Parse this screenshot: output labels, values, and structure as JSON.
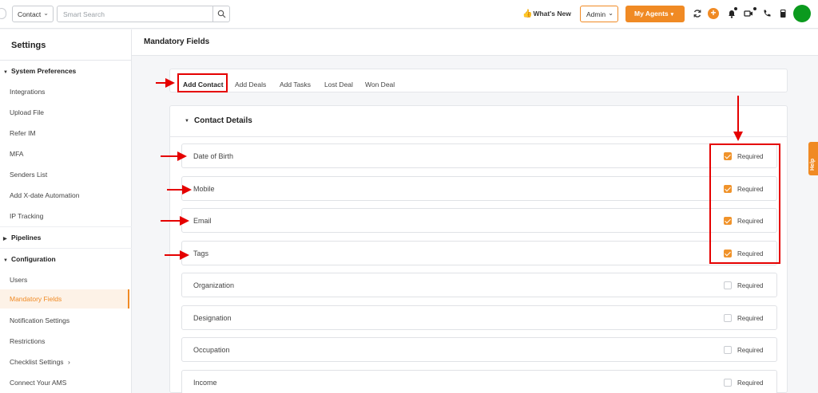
{
  "topbar": {
    "entity_select": "Contact",
    "search_placeholder": "Smart Search",
    "whats_new": "What's New",
    "admin_select": "Admin",
    "agents_button": "My Agents"
  },
  "sidebar": {
    "title": "Settings",
    "groups": {
      "system_preferences": "System Preferences",
      "pipelines": "Pipelines",
      "configuration": "Configuration"
    },
    "items": {
      "integrations": "Integrations",
      "upload_file": "Upload File",
      "refer_im": "Refer IM",
      "mfa": "MFA",
      "senders_list": "Senders List",
      "add_xdate": "Add X-date Automation",
      "ip_tracking": "IP Tracking",
      "users": "Users",
      "mandatory_fields": "Mandatory Fields",
      "notification_settings": "Notification Settings",
      "restrictions": "Restrictions",
      "checklist_settings": "Checklist Settings",
      "connect_ams": "Connect Your AMS"
    }
  },
  "main": {
    "title": "Mandatory Fields",
    "tabs": [
      "Add Contact",
      "Add Deals",
      "Add Tasks",
      "Lost Deal",
      "Won Deal"
    ],
    "section_title": "Contact Details",
    "required_label": "Required",
    "fields": [
      {
        "name": "Date of Birth",
        "required": true
      },
      {
        "name": "Mobile",
        "required": true
      },
      {
        "name": "Email",
        "required": true
      },
      {
        "name": "Tags",
        "required": true
      },
      {
        "name": "Organization",
        "required": false
      },
      {
        "name": "Designation",
        "required": false
      },
      {
        "name": "Occupation",
        "required": false
      },
      {
        "name": "Income",
        "required": false
      }
    ]
  },
  "help_tab": "Help",
  "colors": {
    "accent": "#f08a24",
    "annotation": "#e50000",
    "avatar": "#0b9a1e"
  }
}
